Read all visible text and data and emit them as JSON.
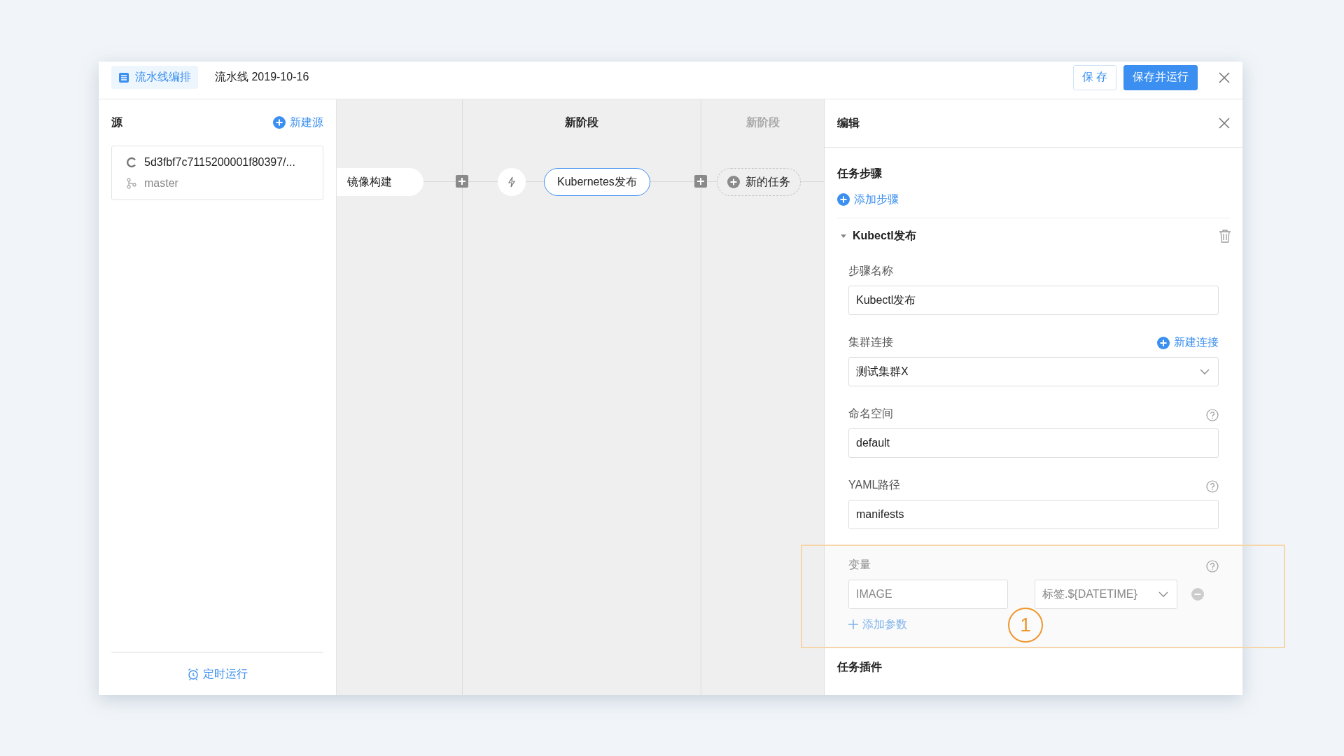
{
  "header": {
    "tag": "流水线编排",
    "title": "流水线 2019-10-16",
    "buttons": [
      {
        "label": "保 存",
        "kind": "secondary"
      },
      {
        "label": "保存并运行",
        "kind": "primary"
      }
    ]
  },
  "sources": {
    "title": "源",
    "add": "新建源",
    "items": [
      {
        "commit": "5d3fbf7c7115200001f80397/...",
        "branch": "master"
      }
    ],
    "footer": "定时运行"
  },
  "stages": [
    {
      "kind": "stage",
      "nodes": [
        {
          "kind": "task",
          "label": "镜像构建",
          "selected": false
        }
      ]
    },
    {
      "kind": "stage",
      "title": "新阶段",
      "nodes": [
        {
          "kind": "trigger"
        },
        {
          "kind": "task",
          "label": "Kubernetes发布",
          "selected": true
        }
      ]
    },
    {
      "kind": "placeholder",
      "title": "新阶段",
      "nodes": [
        {
          "kind": "new",
          "label": "新的任务"
        }
      ]
    }
  ],
  "editor": {
    "title": "编辑",
    "section": "任务步骤",
    "add_step": "添加步骤",
    "step": {
      "name": "Kubectl发布",
      "expanded": true,
      "fields": [
        {
          "kind": "input",
          "label": "步骤名称",
          "value": "Kubectl发布",
          "help": false
        },
        {
          "kind": "select",
          "label": "集群连接",
          "value": "测试集群X",
          "action": "新建连接",
          "help": false
        },
        {
          "kind": "input",
          "label": "命名空间",
          "value": "default",
          "help": true
        },
        {
          "kind": "input",
          "label": "YAML路径",
          "value": "manifests",
          "help": true
        }
      ],
      "variables": {
        "label": "变量",
        "disabled": true,
        "help": true,
        "rows": [
          {
            "name": "IMAGE",
            "value": "标签.${DATETIME}"
          }
        ],
        "add": "添加参数"
      }
    },
    "next_section": "任务插件"
  },
  "annotation": {
    "label": "1"
  }
}
